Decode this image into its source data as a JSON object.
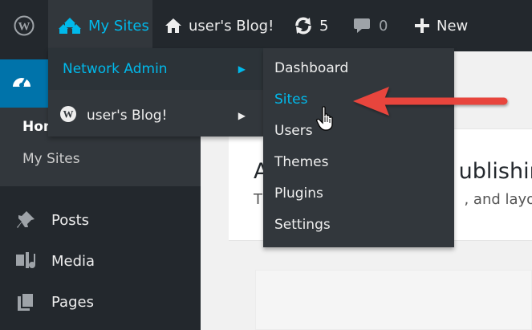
{
  "admin_bar": {
    "my_sites": "My Sites",
    "site_name": "user's Blog!",
    "updates_count": "5",
    "comments_count": "0",
    "new_label": "New"
  },
  "admin_menu": {
    "submenu": {
      "home": "Hom",
      "my_sites": "My Sites"
    },
    "items": [
      {
        "label": "Posts",
        "icon": "pin-icon"
      },
      {
        "label": "Media",
        "icon": "media-icon"
      },
      {
        "label": "Pages",
        "icon": "pages-icon"
      }
    ]
  },
  "my_sites_menu": {
    "items": [
      {
        "label": "Network Admin",
        "state": "active"
      },
      {
        "label": "user's Blog!",
        "state": "default"
      }
    ],
    "network_admin_submenu": [
      {
        "label": "Dashboard",
        "state": "default"
      },
      {
        "label": "Sites",
        "state": "hover"
      },
      {
        "label": "Users",
        "state": "default"
      },
      {
        "label": "Themes",
        "state": "default"
      },
      {
        "label": "Plugins",
        "state": "default"
      },
      {
        "label": "Settings",
        "state": "default"
      }
    ]
  },
  "content": {
    "heading_fragment_left": "A",
    "heading_fragment_right": "ublishin",
    "text_fragment_left": "T",
    "text_fragment_right": ", and layo"
  },
  "colors": {
    "admin_bar_bg": "#23282d",
    "menu_bg": "#32373c",
    "accent_blue": "#00b9eb",
    "active_menu_blue": "#0073aa",
    "annotation_red": "#e8453c"
  }
}
